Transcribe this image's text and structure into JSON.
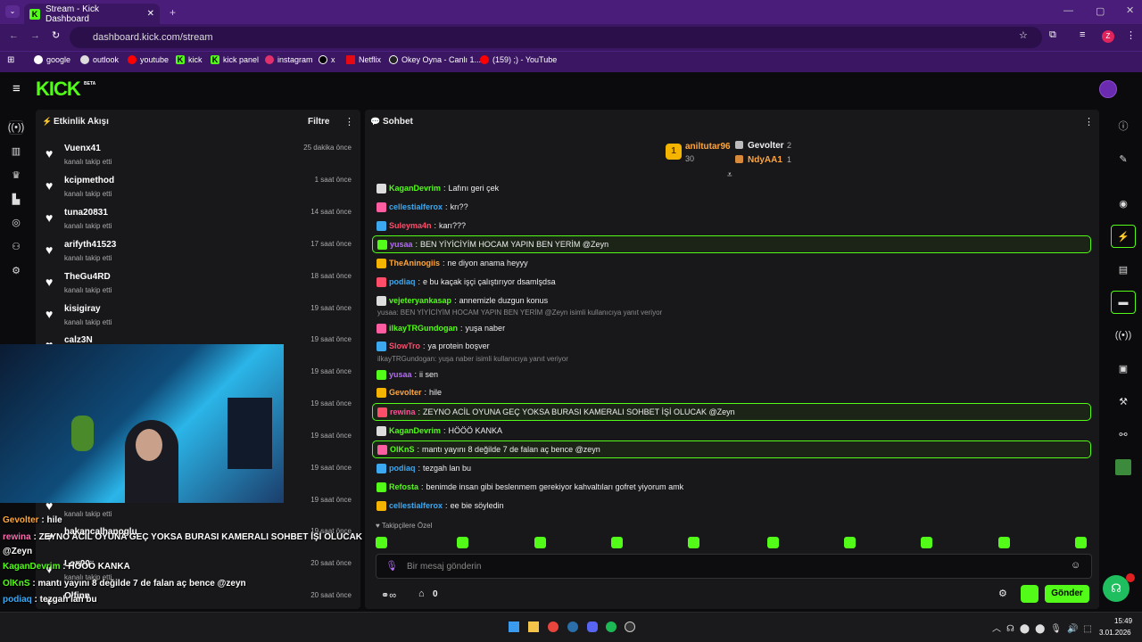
{
  "browser": {
    "tab_title": "Stream - Kick Dashboard",
    "url": "dashboard.kick.com/stream",
    "profile": "Z",
    "bookmarks": [
      "google",
      "outlook",
      "youtube",
      "kick",
      "kick panel",
      "instagram",
      "x",
      "Netflix",
      "Okey Oyna - Canlı 1...",
      "(159) ;) - YouTube"
    ]
  },
  "kick": {
    "logo": "KICK",
    "beta": "BETA"
  },
  "activity": {
    "title": "Etkinlik Akışı",
    "filter": "Filtre",
    "items": [
      {
        "name": "Vuenx41",
        "sub": "kanalı takip etti",
        "time": "25 dakika önce"
      },
      {
        "name": "kcipmethod",
        "sub": "kanalı takip etti",
        "time": "1 saat önce"
      },
      {
        "name": "tuna20831",
        "sub": "kanalı takip etti",
        "time": "14 saat önce"
      },
      {
        "name": "arifyth41523",
        "sub": "kanalı takip etti",
        "time": "17 saat önce"
      },
      {
        "name": "TheGu4RD",
        "sub": "kanalı takip etti",
        "time": "18 saat önce"
      },
      {
        "name": "kisigiray",
        "sub": "kanalı takip etti",
        "time": "19 saat önce"
      },
      {
        "name": "calz3N",
        "sub": "",
        "time": "19 saat önce"
      },
      {
        "name": "",
        "sub": "",
        "time": "19 saat önce"
      },
      {
        "name": "",
        "sub": "",
        "time": "19 saat önce"
      },
      {
        "name": "",
        "sub": "",
        "time": "19 saat önce"
      },
      {
        "name": "",
        "sub": "",
        "time": "19 saat önce"
      },
      {
        "name": "",
        "sub": "kanalı takip etti",
        "time": "19 saat önce"
      },
      {
        "name": "hakancalhanoglu",
        "sub": "",
        "time": "19 saat önce"
      },
      {
        "name": "Lox00",
        "sub": "kanalı takip etti",
        "time": "20 saat önce"
      },
      {
        "name": "Olfinn",
        "sub": "",
        "time": "20 saat önce"
      }
    ]
  },
  "chat": {
    "title": "Sohbet",
    "leaderboard": {
      "first": "aniltutar96",
      "first_score": "30",
      "rank": "1",
      "second": "Gevolter",
      "second_score": "2",
      "third": "NdyAA1",
      "third_score": "1"
    },
    "messages": [
      {
        "user": "KaganDevrim",
        "color": "#53fc18",
        "text": "Lafını geri çek",
        "hl": false
      },
      {
        "user": "cellestialferox",
        "color": "#3ca8f0",
        "text": "krı??",
        "hl": false
      },
      {
        "user": "Suleyma4n",
        "color": "#ff4d6a",
        "text": "karı???",
        "hl": false
      },
      {
        "user": "yusaa",
        "color": "#b26ef0",
        "text": "BEN YİYİCİYİM HOCAM YAPIN BEN YERİM @Zeyn",
        "hl": true
      },
      {
        "user": "TheAninogiis",
        "color": "#ffa63c",
        "text": "ne diyon anama heyyy",
        "hl": false
      },
      {
        "user": "podiaq",
        "color": "#3ca8f0",
        "text": "e bu kaçak işçi çalıştırıyor dsamlşdsa",
        "hl": false
      },
      {
        "user": "vejeteryankasap",
        "color": "#53fc18",
        "text": "annemizle duzgun konus",
        "hl": false
      },
      {
        "user": "ilkayTRGundogan",
        "color": "#53fc18",
        "text": "yuşa naber",
        "hl": false,
        "reply": "yusaa: BEN YİYİCİYİM HOCAM YAPIN BEN YERİM @Zeyn isimli kullanıcıya yanıt veriyor"
      },
      {
        "user": "SlowTro",
        "color": "#ff4d6a",
        "text": "ya protein boşver",
        "hl": false
      },
      {
        "user": "yusaa",
        "color": "#b26ef0",
        "text": "ii sen",
        "hl": false,
        "reply": "ilkayTRGundogan: yuşa naber isimli kullanıcıya yanıt veriyor"
      },
      {
        "user": "Gevolter",
        "color": "#ffa63c",
        "text": "hile",
        "hl": false
      },
      {
        "user": "rewina",
        "color": "#ff4d9a",
        "text": "ZEYNO ACİL OYUNA GEÇ YOKSA BURASI KAMERALI SOHBET İŞİ OLUCAK @Zeyn",
        "hl": true
      },
      {
        "user": "KaganDevrim",
        "color": "#53fc18",
        "text": "HÖÖÖ KANKA",
        "hl": false
      },
      {
        "user": "OlKnS",
        "color": "#53fc18",
        "text": "mantı yayını 8 değilde 7 de falan aç bence @zeyn",
        "hl": true
      },
      {
        "user": "podiaq",
        "color": "#3ca8f0",
        "text": "tezgah lan bu",
        "hl": false
      },
      {
        "user": "Refosta",
        "color": "#53fc18",
        "text": "benimde insan gibi beslenmem gerekiyor kahvaltıları gofret yiyorum amk",
        "hl": false
      },
      {
        "user": "cellestialferox",
        "color": "#3ca8f0",
        "text": "ee bie söyledin",
        "hl": false
      }
    ],
    "followers_only": "Takipçilere Özel",
    "placeholder": "Bir mesaj gönderin",
    "send": "Gönder",
    "points": "0"
  },
  "overlay": [
    {
      "user": "Gevolter",
      "text": "hile",
      "color": "#ffa63c"
    },
    {
      "user": "rewina",
      "text": "ZEYNO ACİL OYUNA GEÇ YOKSA BURASI KAMERALI SOHBET İŞİ OLUCAK",
      "color": "#ff6ab0"
    },
    {
      "user": "",
      "text": "@Zeyn",
      "color": "#fff"
    },
    {
      "user": "KaganDevrim",
      "text": "HÖÖÖ KANKA",
      "color": "#53fc18"
    },
    {
      "user": "OlKnS",
      "text": "mantı yayını 8 değilde 7 de falan aç bence @zeyn",
      "color": "#53fc18"
    },
    {
      "user": "podiaq",
      "text": "tezgah lan bu",
      "color": "#3ca8f0"
    },
    {
      "user": "Refosta",
      "text": "benimde insan gibi beslenmem gerekiyor kahvaltıları gofret yiyorum amk",
      "color": "#b26ef0"
    },
    {
      "user": "cellestialferox",
      "text": "ee bie söyledin",
      "color": "#3ca8f0"
    }
  ],
  "taskbar": {
    "time": "15:49",
    "date": "3.01.2026"
  }
}
